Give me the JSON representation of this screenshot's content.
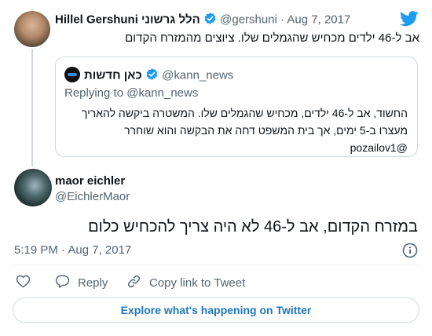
{
  "parent_tweet": {
    "display_name": "Hillel Gershuni הלל גרשוני",
    "handle": "@gershuni",
    "date": "· Aug 7, 2017",
    "text": "אב ל-46 ילדים מכחיש שהגמלים שלו. ציוצים מהמזרח הקדום"
  },
  "quoted_tweet": {
    "display_name": "כאן חדשות",
    "handle": "@kann_news",
    "replying_label": "Replying to",
    "replying_handle": "@kann_news",
    "line1": "החשוד, אב ל-46 ילדים, מכחיש שהגמלים שלו. המשטרה ביקשה להאריך",
    "line2": "מעצרו ב-5 ימים, אך בית המשפט דחה את הבקשה והוא שוחרר",
    "line3": "@pozailov1"
  },
  "main_tweet": {
    "display_name": "maor eichler",
    "handle": "@EichlerMaor",
    "text": "במזרח הקדום, אב ל-46 לא היה צריך להכחיש כלום",
    "time": "5:19 PM",
    "date": "Aug 7, 2017"
  },
  "actions": {
    "reply_label": "Reply",
    "copy_link_label": "Copy link to Tweet"
  },
  "explore_label": "Explore what's happening on Twitter",
  "colors": {
    "twitter_blue": "#1d9bf0",
    "link_blue": "#1d76bd",
    "muted": "#536471",
    "border": "#cfd9de"
  },
  "icons": [
    "twitter-bird-icon",
    "verified-badge-icon",
    "info-icon",
    "heart-icon",
    "reply-icon",
    "link-icon"
  ]
}
